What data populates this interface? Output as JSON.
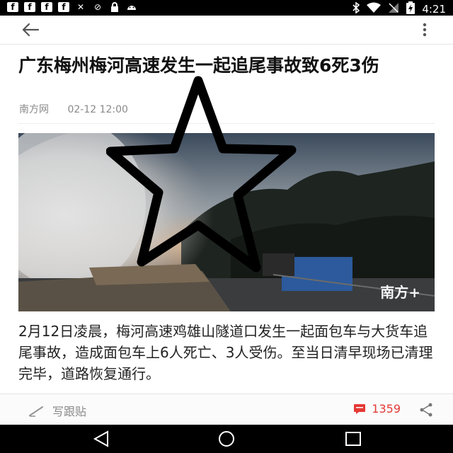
{
  "status_bar": {
    "left_icons": [
      {
        "name": "facebook-icon",
        "glyph": "f"
      },
      {
        "name": "facebook-icon",
        "glyph": "f"
      },
      {
        "name": "facebook-icon",
        "glyph": "f"
      },
      {
        "name": "facebook-icon",
        "glyph": "f"
      },
      {
        "name": "mute-icon",
        "glyph": "✕"
      },
      {
        "name": "sync-icon",
        "glyph": "⊘"
      },
      {
        "name": "lock-icon",
        "glyph": "🔒"
      },
      {
        "name": "android-icon",
        "glyph": "◉"
      }
    ],
    "time": "4:21"
  },
  "app_bar": {
    "back_icon": "back-arrow-icon",
    "menu_icon": "more-vert-icon"
  },
  "article": {
    "title": "广东梅州梅河高速发生一起追尾事故致6死3伤",
    "source": "南方网",
    "datetime": "02-12 12:00",
    "image_watermark": "南方+",
    "body": "2月12日凌晨，梅河高速鸡雄山隧道口发生一起面包车与大货车追尾事故，造成面包车上6人死亡、3人受伤。至当日清早现场已清理完毕，道路恢复通行。"
  },
  "action_bar": {
    "write_label": "写跟贴",
    "comment_count": "1359",
    "accent_color": "#e53935"
  },
  "nav_bar": {
    "buttons": [
      "back-icon",
      "home-icon",
      "recents-icon"
    ]
  }
}
